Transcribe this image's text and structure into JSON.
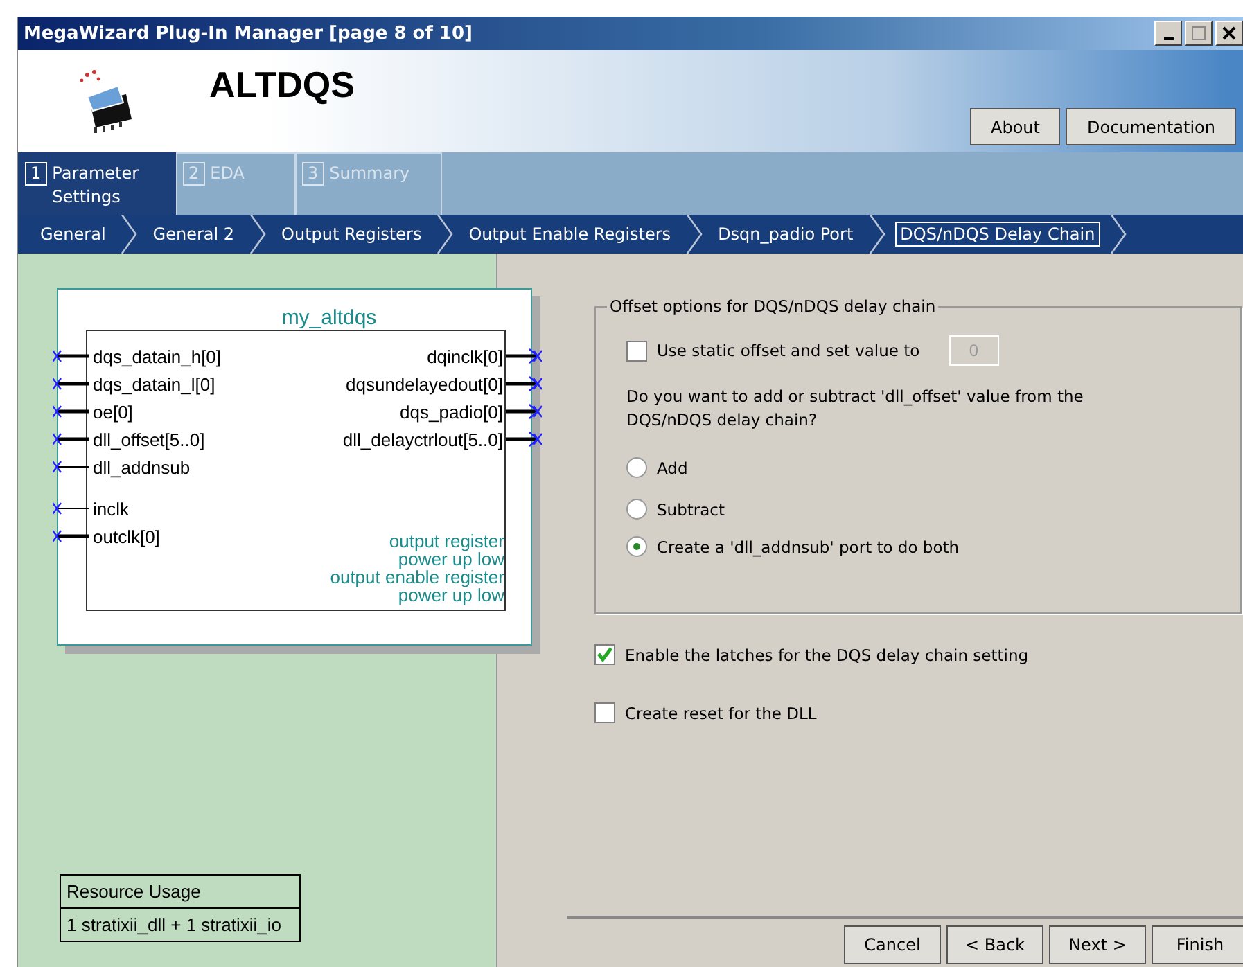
{
  "window": {
    "title": "MegaWizard Plug-In Manager [page 8 of 10]"
  },
  "header": {
    "title": "ALTDQS",
    "buttons": [
      "About",
      "Documentation"
    ]
  },
  "steps": [
    {
      "number": "1",
      "label": "Parameter Settings",
      "selected": true
    },
    {
      "number": "2",
      "label": "EDA",
      "selected": false
    },
    {
      "number": "3",
      "label": "Summary",
      "selected": false
    }
  ],
  "breadcrumbs": [
    {
      "label": "General",
      "selected": false
    },
    {
      "label": "General 2",
      "selected": false
    },
    {
      "label": "Output Registers",
      "selected": false
    },
    {
      "label": "Output Enable Registers",
      "selected": false
    },
    {
      "label": "Dsqn_padio Port",
      "selected": false
    },
    {
      "label": "DQS/nDQS Delay Chain",
      "selected": true
    }
  ],
  "diagram": {
    "title": "my_altdqs",
    "inputs": [
      {
        "name": "dqs_datain_h[0]",
        "bus": true
      },
      {
        "name": "dqs_datain_l[0]",
        "bus": true
      },
      {
        "name": "oe[0]",
        "bus": true
      },
      {
        "name": "dll_offset[5..0]",
        "bus": true
      },
      {
        "name": "dll_addnsub",
        "bus": false
      },
      {
        "name": "inclk",
        "bus": false
      },
      {
        "name": "outclk[0]",
        "bus": true
      }
    ],
    "outputs": [
      {
        "name": "dqinclk[0]",
        "bus": true
      },
      {
        "name": "dqsundelayedout[0]",
        "bus": true
      },
      {
        "name": "dqs_padio[0]",
        "bus": true
      },
      {
        "name": "dll_delayctrlout[5..0]",
        "bus": true
      }
    ],
    "notes": [
      "output register",
      "power up low",
      "output enable register",
      "power up low"
    ]
  },
  "resource_usage": {
    "title": "Resource Usage",
    "value": "1 stratixii_dll + 1 stratixii_io"
  },
  "offset_group": {
    "title": "Offset options for DQS/nDQS delay chain",
    "static_offset": {
      "label": "Use static offset and set value to",
      "checked": false,
      "value": "0",
      "disabled": true
    },
    "question": "Do you want to add or subtract 'dll_offset' value from the DQS/nDQS delay chain?",
    "options": [
      {
        "label": "Add",
        "selected": false
      },
      {
        "label": "Subtract",
        "selected": false
      },
      {
        "label": "Create a 'dll_addnsub' port to do both",
        "selected": true
      }
    ]
  },
  "checkboxes": [
    {
      "label": "Enable the latches for the DQS delay chain setting",
      "checked": true
    },
    {
      "label": "Create reset for the DLL",
      "checked": false
    }
  ],
  "footer_buttons": [
    "Cancel",
    "< Back",
    "Next >",
    "Finish"
  ]
}
